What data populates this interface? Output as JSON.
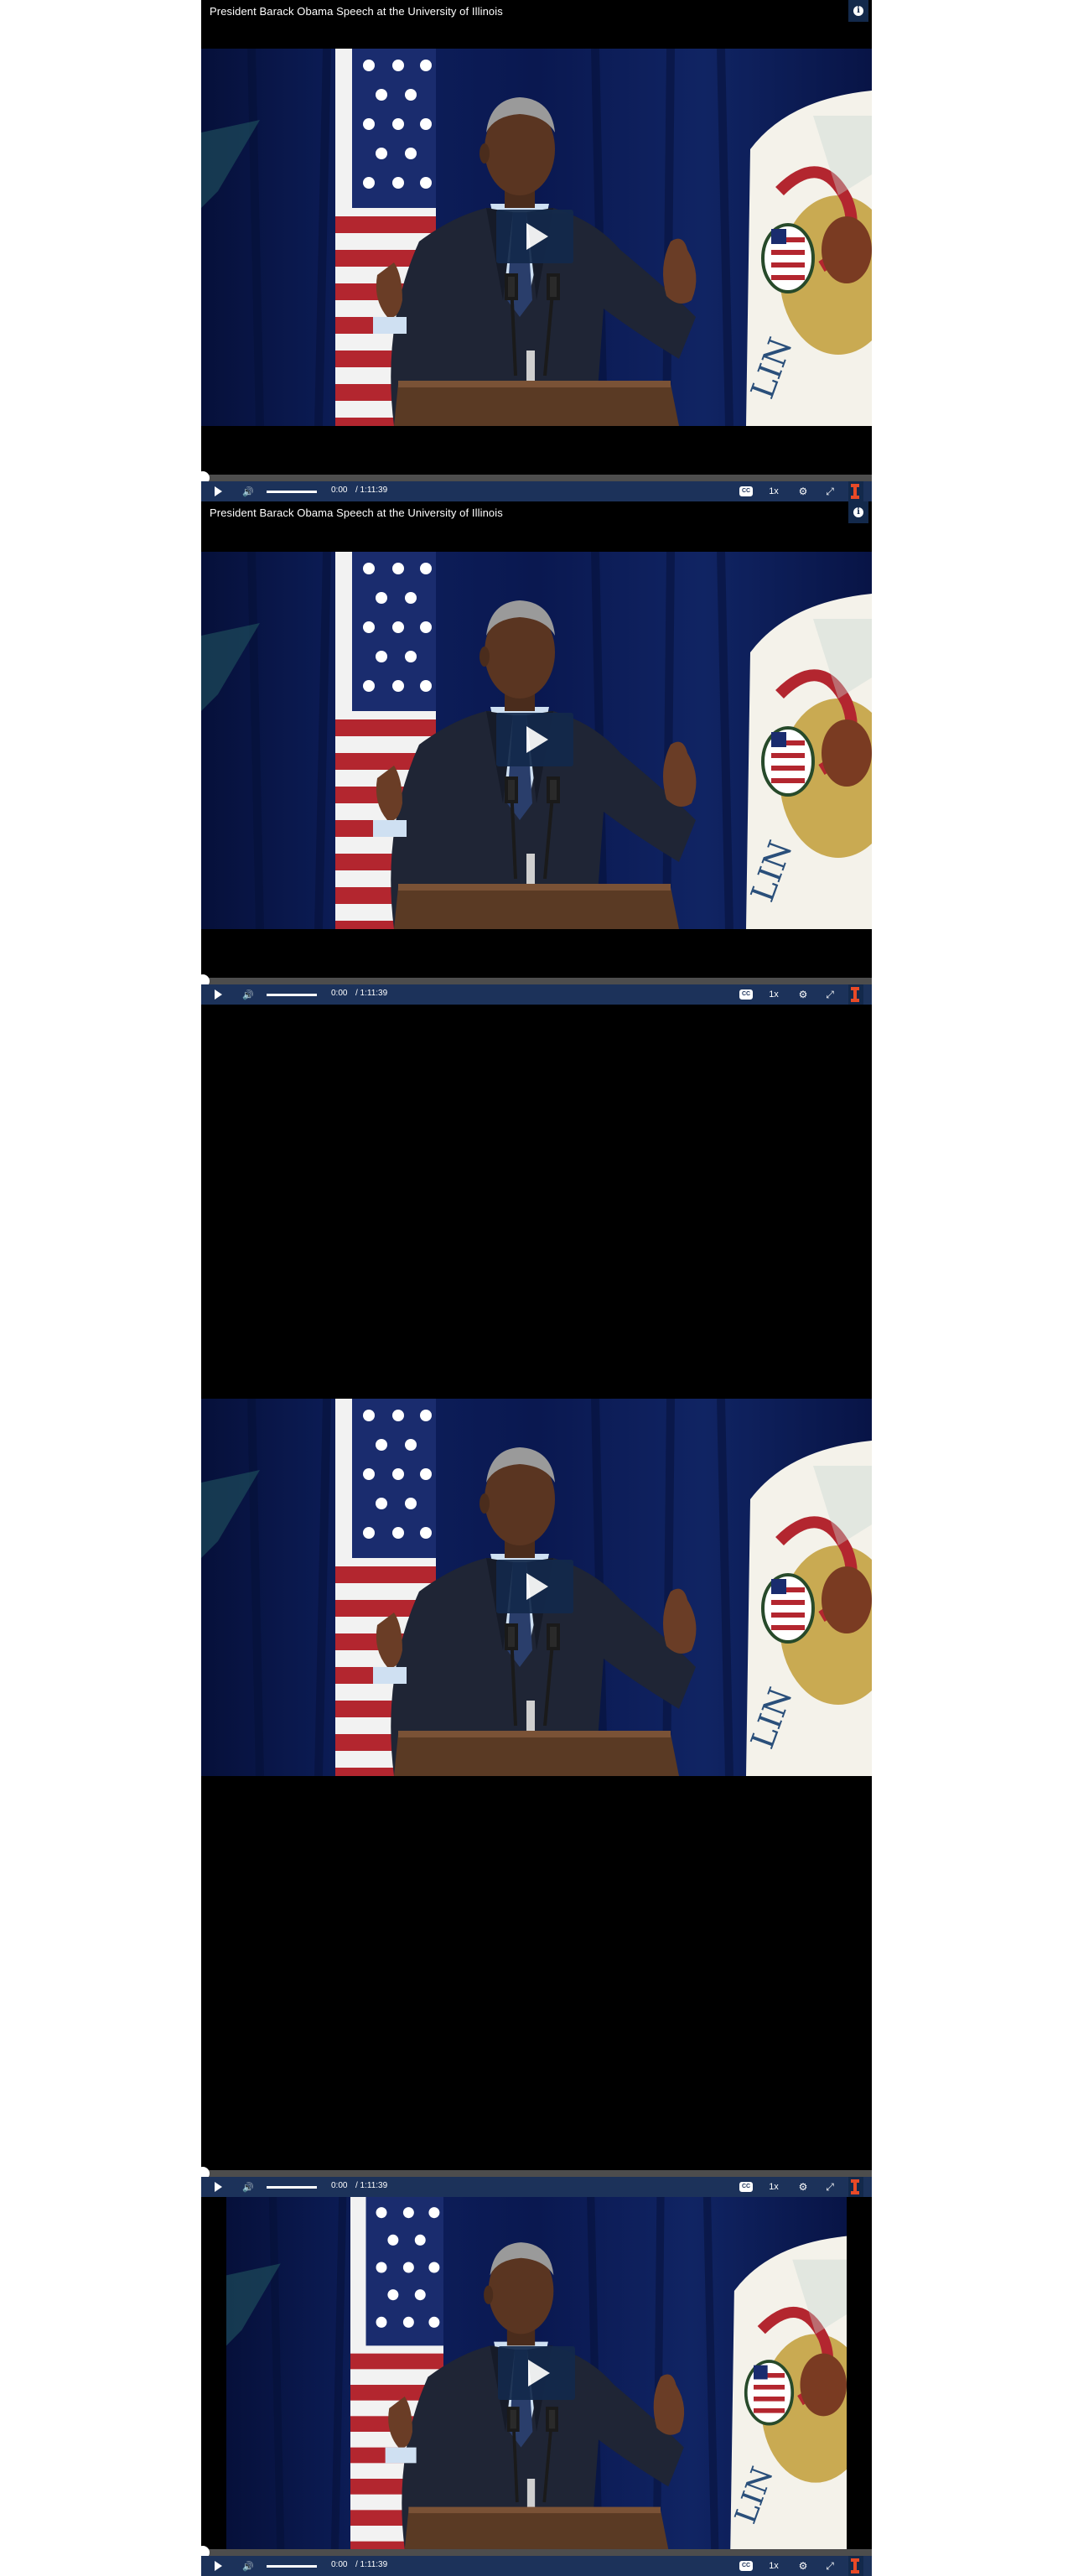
{
  "players": [
    {
      "title": "President Barack Obama Speech at the University of Illinois",
      "controls": {
        "current_time": "0:00",
        "duration": "/ 1:11:39",
        "speed": "1x"
      },
      "progress": 0
    },
    {
      "title": "President Barack Obama Speech at the University of Illinois",
      "controls": {
        "current_time": "0:00",
        "duration": "/ 1:11:39",
        "speed": "1x"
      },
      "progress": 0
    },
    {
      "controls": {
        "current_time": "0:00",
        "duration": "/ 1:11:39",
        "speed": "1x"
      },
      "progress": 0
    },
    {
      "controls": {
        "current_time": "0:00",
        "duration": "/ 1:11:39",
        "speed": "1x"
      },
      "progress": 0
    }
  ],
  "icons": {
    "info": "info-icon",
    "play": "play-icon",
    "volume": "volume-icon",
    "captions": "closed-captions-icon",
    "settings": "gear-icon",
    "fullscreen": "fullscreen-icon",
    "logo": "illinois-block-i-logo"
  },
  "colors": {
    "control_bar": "#1c325a",
    "big_play_button": "#13294b",
    "illinois_orange": "#e84a27",
    "curtain": "#0b1a4a"
  }
}
